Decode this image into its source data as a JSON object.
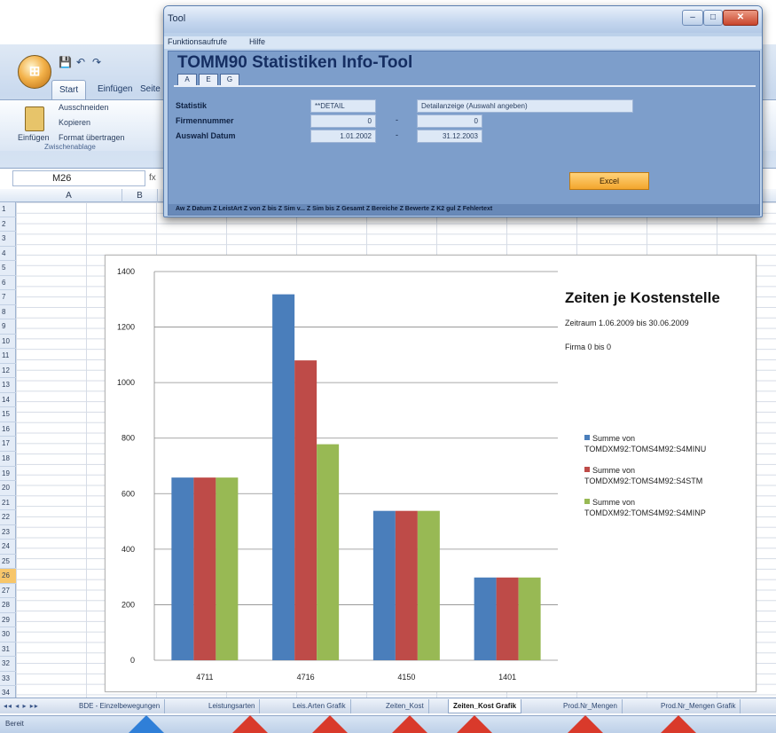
{
  "excel": {
    "qat_items": [
      "💾",
      "↶",
      "↷"
    ],
    "ribbon_tabs": [
      "Start",
      "Einfügen",
      "Seite"
    ],
    "clipboard": {
      "paste_label": "Einfügen",
      "cut_label": "Ausschneiden",
      "copy_label": "Kopieren",
      "format_label": "Format übertragen",
      "group_label": "Zwischenablage"
    },
    "name_box": "M26",
    "fx_label": "fx",
    "columns": [
      "A",
      "B"
    ],
    "rows": [
      "1",
      "2",
      "3",
      "4",
      "5",
      "6",
      "7",
      "8",
      "9",
      "10",
      "11",
      "12",
      "13",
      "14",
      "15",
      "16",
      "17",
      "18",
      "19",
      "20",
      "21",
      "22",
      "23",
      "24",
      "25",
      "26",
      "27",
      "28",
      "29",
      "30",
      "31",
      "32",
      "33",
      "34"
    ],
    "selected_row": "26",
    "sheet_tabs": [
      "BDE - Einzelbewegungen",
      "Leistungsarten",
      "Leis.Arten Grafik",
      "Zeiten_Kost",
      "Zeiten_Kost Grafik",
      "Prod.Nr_Mengen",
      "Prod.Nr_Mengen Grafik"
    ],
    "active_tab": "Zeiten_Kost Grafik",
    "tab_nav": "◂◂ ◂ ▸ ▸▸",
    "status": "Bereit",
    "arrow_colors": {
      "blue": "#2f7fd8",
      "red": "#d93a2b"
    }
  },
  "chart_data": {
    "type": "bar",
    "title": "Zeiten je Kostenstelle",
    "subtitle_period": "Zeitraum  1.06.2009 bis 30.06.2009",
    "subtitle_firm": "Firma 0 bis 0",
    "categories": [
      "4711",
      "4716",
      "4150",
      "1401"
    ],
    "series": [
      {
        "name": "Summe von TOMDXM92:TOMS4M92:S4MINU",
        "color": "#4a7ebb",
        "values": [
          658,
          1318,
          538,
          298
        ]
      },
      {
        "name": "Summe von TOMDXM92:TOMS4M92:S4STM",
        "color": "#be4b48",
        "values": [
          658,
          1080,
          538,
          298
        ]
      },
      {
        "name": "Summe von TOMDXM92:TOMS4M92:S4MINP",
        "color": "#98b954",
        "values": [
          658,
          778,
          538,
          298
        ]
      }
    ],
    "yticks": [
      "0",
      "200",
      "400",
      "600",
      "800",
      "1000",
      "1200",
      "1400"
    ],
    "ylim": [
      0,
      1400
    ],
    "grid": true,
    "legend_position": "right"
  },
  "tool": {
    "window_title": "Tool",
    "window_buttons": {
      "min": "–",
      "max": "□",
      "close": "✕"
    },
    "menu": [
      "Funktionsaufrufe",
      "Hilfe"
    ],
    "heading": "TOMM90  Statistiken Info-Tool",
    "tabs": [
      "A",
      "E",
      "G"
    ],
    "labels": {
      "statistik": "Statistik",
      "firmennummer": "Firmennummer",
      "auswahl_datum": "Auswahl Datum"
    },
    "fields": {
      "statistik_code": "**DETAIL",
      "statistik_desc": "Detailanzeige (Auswahl angeben)",
      "firma_from": "0",
      "firma_to": "0",
      "datum_from": "1.01.2002",
      "datum_to": "31.12.2003"
    },
    "dash": "-",
    "execute_button": "Excel",
    "footer": "Aw Z Datum     Z LeistArt    Z von    Z bis     Z Sim v... Z Sim bis Z Gesamt   Z Bereiche  Z Bewerte  Z K2  gul Z Fehlertext"
  }
}
